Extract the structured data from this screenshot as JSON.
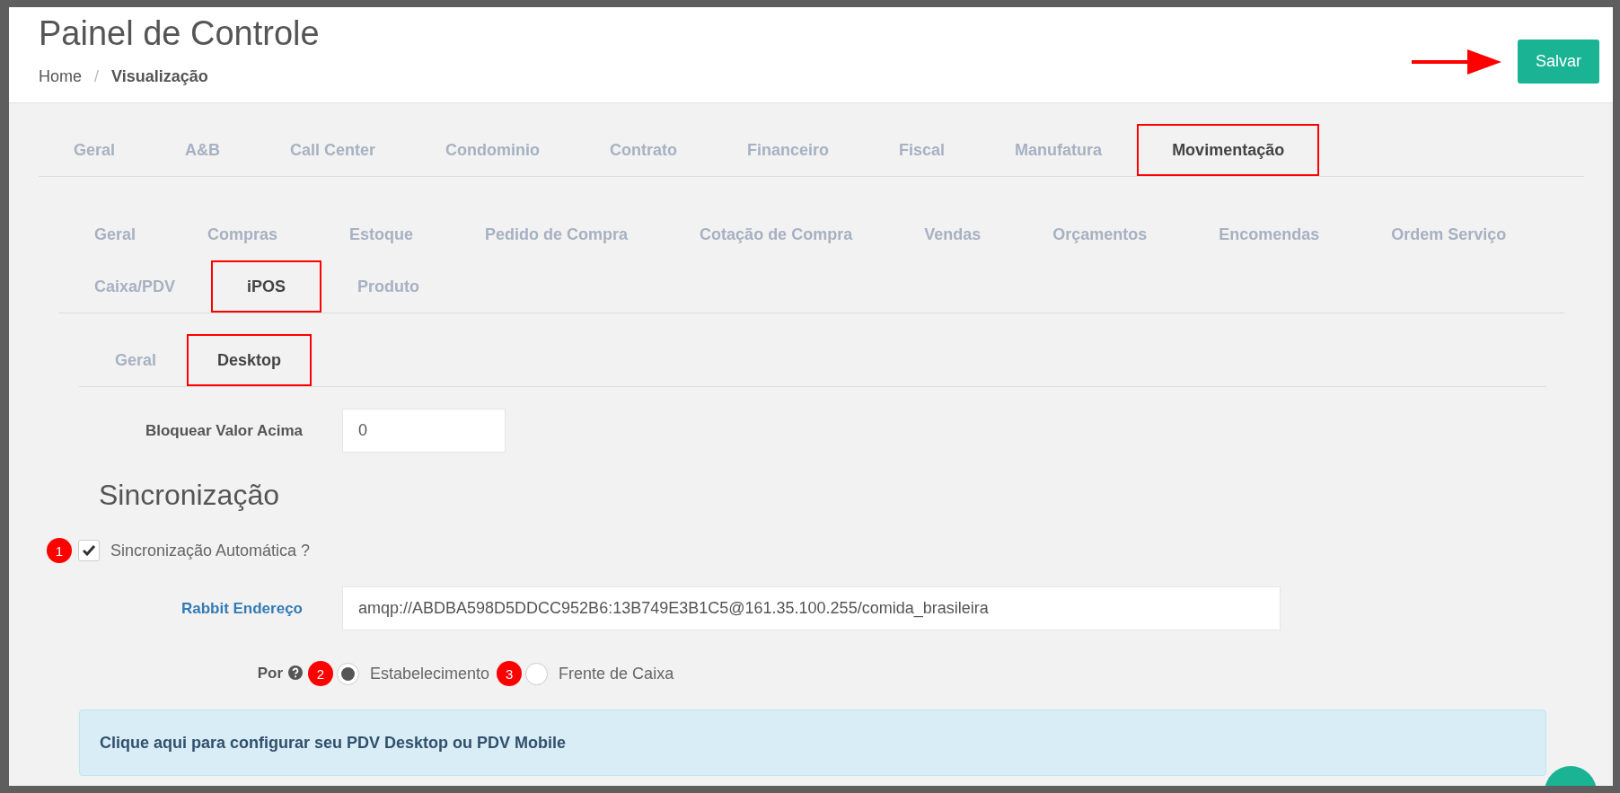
{
  "header": {
    "title": "Painel de Controle",
    "breadcrumb_separator": "/",
    "breadcrumb": [
      {
        "label": "Home",
        "current": false
      },
      {
        "label": "Visualização",
        "current": true
      }
    ],
    "save_button": "Salvar"
  },
  "tabs_level_1": [
    {
      "label": "Geral",
      "selected": false
    },
    {
      "label": "A&B",
      "selected": false
    },
    {
      "label": "Call Center",
      "selected": false
    },
    {
      "label": "Condominio",
      "selected": false
    },
    {
      "label": "Contrato",
      "selected": false
    },
    {
      "label": "Financeiro",
      "selected": false
    },
    {
      "label": "Fiscal",
      "selected": false
    },
    {
      "label": "Manufatura",
      "selected": false
    },
    {
      "label": "Movimentação",
      "selected": true
    }
  ],
  "tabs_level_2": [
    {
      "label": "Geral",
      "selected": false
    },
    {
      "label": "Compras",
      "selected": false
    },
    {
      "label": "Estoque",
      "selected": false
    },
    {
      "label": "Pedido de Compra",
      "selected": false
    },
    {
      "label": "Cotação de Compra",
      "selected": false
    },
    {
      "label": "Vendas",
      "selected": false
    },
    {
      "label": "Orçamentos",
      "selected": false
    },
    {
      "label": "Encomendas",
      "selected": false
    },
    {
      "label": "Ordem Serviço",
      "selected": false
    },
    {
      "label": "Caixa/PDV",
      "selected": false
    },
    {
      "label": "iPOS",
      "selected": true
    },
    {
      "label": "Produto",
      "selected": false
    }
  ],
  "tabs_level_3": [
    {
      "label": "Geral",
      "selected": false
    },
    {
      "label": "Desktop",
      "selected": true
    }
  ],
  "form": {
    "block_value": {
      "label": "Bloquear Valor Acima",
      "value": "0"
    },
    "section_title": "Sincronização",
    "auto_sync": {
      "badge": "1",
      "label": "Sincronização Automática ?",
      "checked": true
    },
    "rabbit_address": {
      "label": "Rabbit Endereço",
      "value": "amqp://ABDBA598D5DDCC952B6:13B749E3B1C5@161.35.100.255/comida_brasileira"
    },
    "by": {
      "label": "Por",
      "options": [
        {
          "badge": "2",
          "label": "Estabelecimento",
          "selected": true
        },
        {
          "badge": "3",
          "label": "Frente de Caixa",
          "selected": false
        }
      ]
    }
  },
  "alert": "Clique aqui para configurar seu PDV Desktop ou PDV Mobile"
}
